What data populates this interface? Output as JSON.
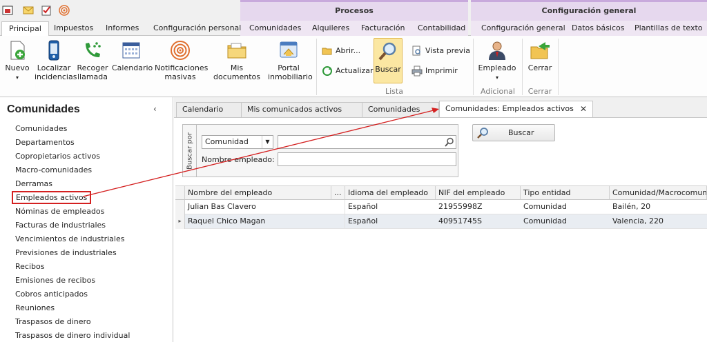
{
  "colors": {
    "accent_red": "#d42020",
    "contextual": "#e6d8ee",
    "selected_row": "#e9edf2"
  },
  "quick_access": [
    "app-icon",
    "mail-icon",
    "task-icon",
    "broadcast-icon"
  ],
  "context_groups": {
    "procesos": "Procesos",
    "config": "Configuración general"
  },
  "ribbon_tabs": {
    "principal": "Principal",
    "impuestos": "Impuestos",
    "informes": "Informes",
    "config_personal": "Configuración personal",
    "comunidades": "Comunidades",
    "alquileres": "Alquileres",
    "facturacion": "Facturación",
    "contabilidad": "Contabilidad",
    "config_general": "Configuración general",
    "datos_basicos": "Datos básicos",
    "plantillas": "Plantillas de texto"
  },
  "ribbon": {
    "nuevo": "Nuevo",
    "localizar": "Localizar incidencias",
    "recoger": "Recoger llamada",
    "calendario": "Calendario",
    "notificaciones": "Notificaciones masivas",
    "documentos": "Mis documentos",
    "portal": "Portal inmobiliario",
    "abrir": "Abrir...",
    "actualizar": "Actualizar",
    "buscar": "Buscar",
    "vista_previa": "Vista previa",
    "imprimir": "Imprimir",
    "grupo_lista": "Lista",
    "empleado": "Empleado",
    "grupo_adicional": "Adicional",
    "cerrar": "Cerrar",
    "grupo_cerrar": "Cerrar"
  },
  "left_panel": {
    "title": "Comunidades",
    "collapse": "‹",
    "items": [
      "Comunidades",
      "Departamentos",
      "Copropietarios activos",
      "Macro-comunidades",
      "Derramas",
      "Empleados activos",
      "Nóminas de empleados",
      "Facturas de industriales",
      "Vencimientos de industriales",
      "Previsiones de industriales",
      "Recibos",
      "Emisiones de recibos",
      "Cobros anticipados",
      "Reuniones",
      "Traspasos de dinero",
      "Traspasos de dinero individual"
    ]
  },
  "doc_tabs": {
    "t1": "Calendario",
    "t2": "Mis comunicados activos",
    "t3": "Comunidades",
    "t4": "Comunidades: Empleados activos",
    "close": "✕"
  },
  "search": {
    "group_label": "Buscar por",
    "combo_value": "Comunidad",
    "combo_arrow": "▼",
    "field_label": "Nombre empleado:",
    "button": "Buscar"
  },
  "grid": {
    "headers": [
      "Nombre del empleado",
      "...",
      "Idioma del empleado",
      "NIF del empleado",
      "Tipo entidad",
      "Comunidad/Macrocomunidad"
    ],
    "rows": [
      [
        "Julian Bas Clavero",
        "",
        "Español",
        "21955998Z",
        "Comunidad",
        "Bailén, 20"
      ],
      [
        "Raquel Chico Magan",
        "",
        "Español",
        "40951745S",
        "Comunidad",
        "Valencia, 220"
      ]
    ],
    "row_marker": "▸"
  }
}
